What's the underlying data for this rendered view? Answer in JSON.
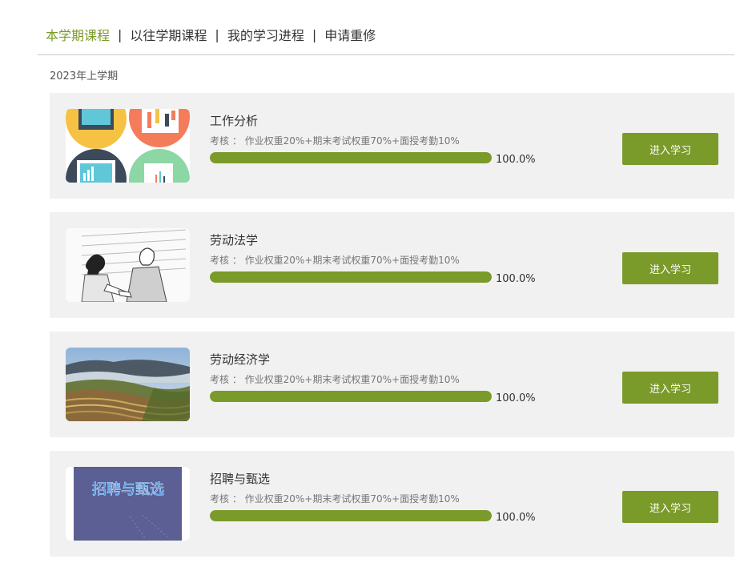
{
  "tabs": [
    "本学期课程",
    "以往学期课程",
    "我的学习进程",
    "申请重修"
  ],
  "separator": "|",
  "colors": {
    "accent": "#7a9a2a",
    "card_bg": "#f1f1f1"
  },
  "term_label": "2023年上学期",
  "courses": [
    {
      "title": "工作分析",
      "assessment": "考核 ： 作业权重20%+期末考试权重70%+面授考勤10%",
      "progress": 1.0,
      "progress_text": "100.0%",
      "button": "进入学习",
      "thumbnail": "analytics-icons-image"
    },
    {
      "title": "劳动法学",
      "assessment": "考核 ： 作业权重20%+期末考试权重70%+面授考勤10%",
      "progress": 1.0,
      "progress_text": "100.0%",
      "button": "进入学习",
      "thumbnail": "handshake-sketch-image"
    },
    {
      "title": "劳动经济学",
      "assessment": "考核 ： 作业权重20%+期末考试权重70%+面授考勤10%",
      "progress": 1.0,
      "progress_text": "100.0%",
      "button": "进入学习",
      "thumbnail": "terraced-fields-photo"
    },
    {
      "title": "招聘与甄选",
      "assessment": "考核 ： 作业权重20%+期末考试权重70%+面授考勤10%",
      "progress": 1.0,
      "progress_text": "100.0%",
      "button": "进入学习",
      "thumbnail": "recruitment-title-image",
      "thumbnail_text": "招聘与甄选"
    }
  ]
}
